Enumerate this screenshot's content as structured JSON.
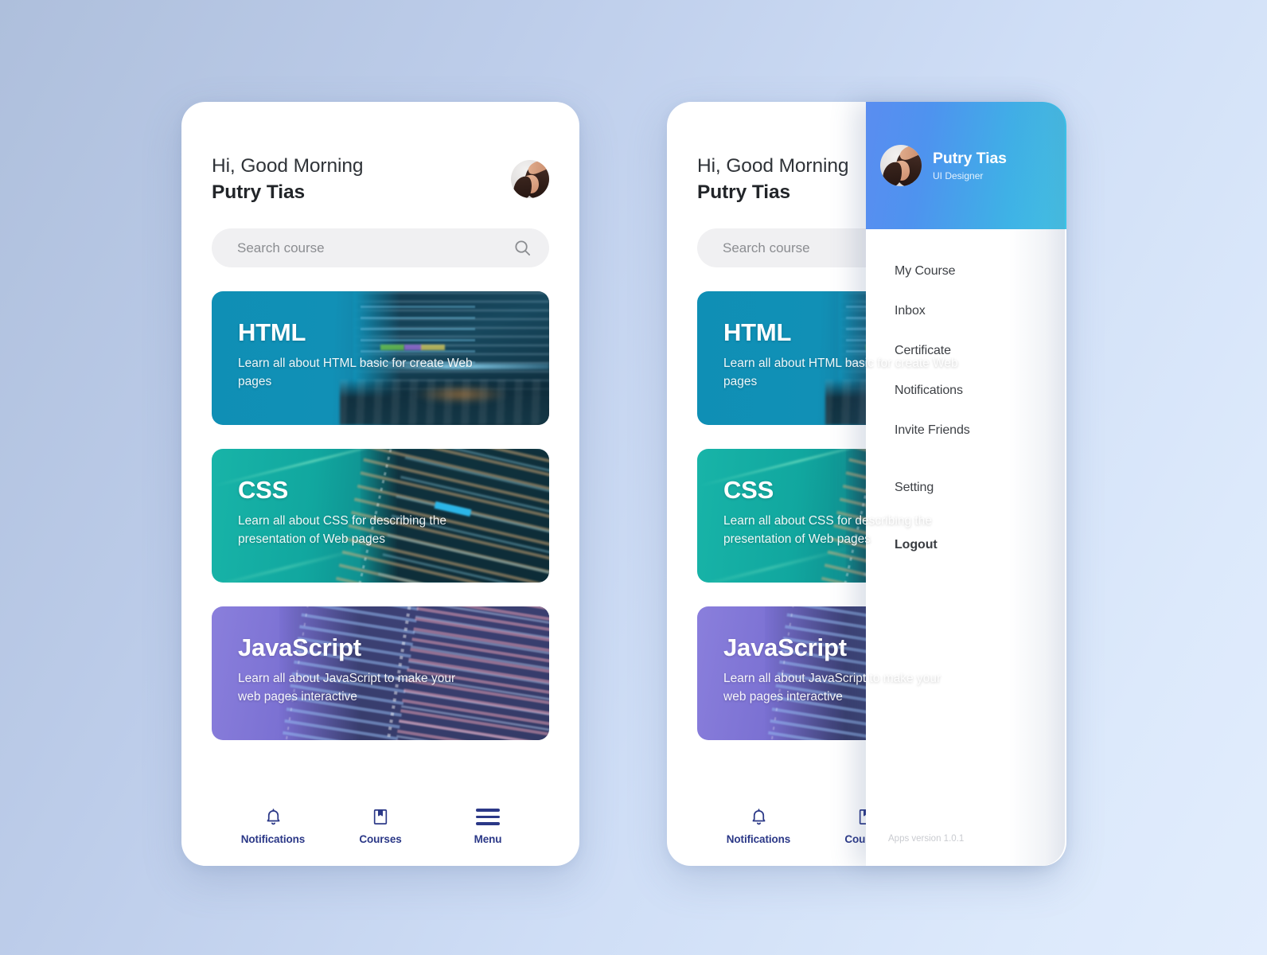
{
  "app": {
    "version_label": "Apps version 1.0.1"
  },
  "header": {
    "greeting": "Hi, Good Morning",
    "user_name": "Putry Tias",
    "avatar_alt": "user-avatar"
  },
  "search": {
    "placeholder": "Search course",
    "icon": "search-icon"
  },
  "courses": [
    {
      "title": "HTML",
      "description": "Learn all about HTML basic for create Web pages",
      "accent": "#1190b6"
    },
    {
      "title": "CSS",
      "description": "Learn all about CSS for describing the presentation of Web pages",
      "accent": "#11a79f"
    },
    {
      "title": "JavaScript",
      "description": "Learn all about JavaScript to make your web pages interactive",
      "accent": "#7a70d2"
    }
  ],
  "bottom_nav": {
    "items": [
      {
        "label": "Notifications",
        "icon": "bell-icon"
      },
      {
        "label": "Courses",
        "icon": "book-bookmark-icon"
      },
      {
        "label": "Menu",
        "icon": "hamburger-menu-icon"
      }
    ],
    "accent": "#2b3887"
  },
  "drawer": {
    "profile": {
      "name": "Putry Tias",
      "role": "UI Designer"
    },
    "gradient_start": "#5a8df0",
    "gradient_end": "#3ac6e9",
    "items": [
      {
        "label": "My Course"
      },
      {
        "label": "Inbox"
      },
      {
        "label": "Certificate"
      },
      {
        "label": "Notifications"
      },
      {
        "label": "Invite Friends"
      },
      {
        "label": "Setting"
      },
      {
        "label": "Logout"
      }
    ]
  },
  "background": {
    "from": "#aebfdc",
    "to": "#e2edfd"
  }
}
